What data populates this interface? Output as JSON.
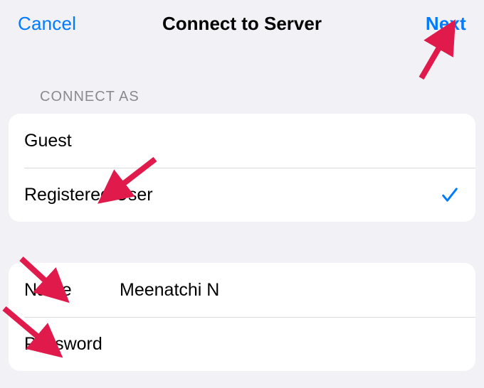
{
  "nav": {
    "cancel_label": "Cancel",
    "title": "Connect to Server",
    "next_label": "Next"
  },
  "connect_as": {
    "header": "Connect As",
    "options": [
      {
        "label": "Guest",
        "selected": false
      },
      {
        "label": "Registered User",
        "selected": true
      }
    ]
  },
  "credentials": {
    "name_label": "Name",
    "name_value": "Meenatchi N",
    "password_label": "Password",
    "password_value": ""
  },
  "colors": {
    "accent": "#007aff",
    "annotation": "#e11a4c",
    "background": "#f2f2f6",
    "cell_bg": "#ffffff",
    "secondary_text": "#8a8a8e"
  }
}
